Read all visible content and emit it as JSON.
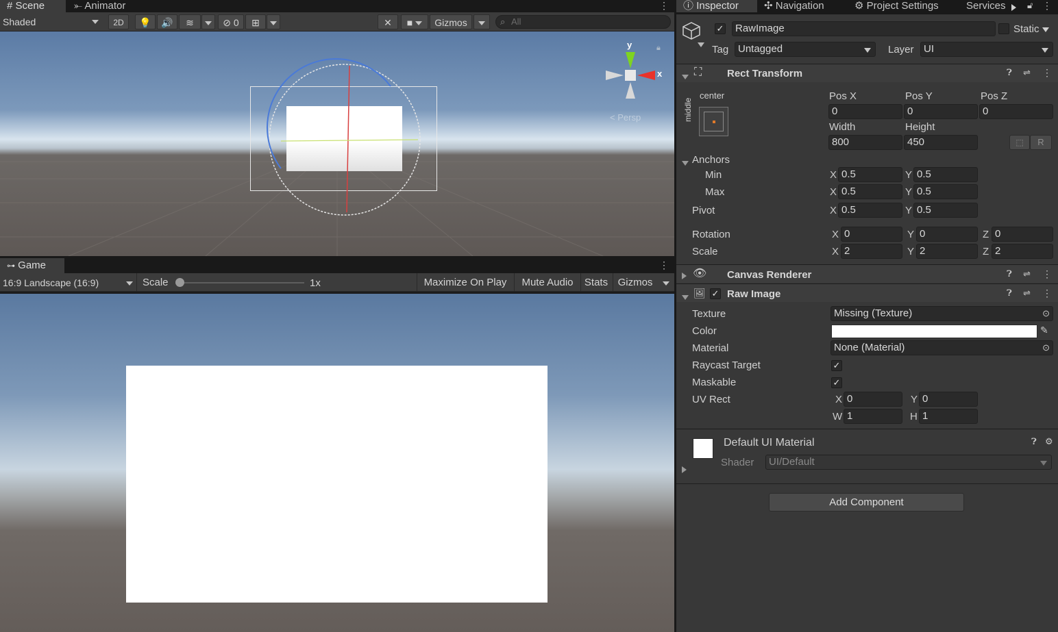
{
  "scene_tabs": {
    "scene": "Scene",
    "animator": "Animator"
  },
  "scene_toolbar": {
    "shading": "Shaded",
    "two_d": "2D",
    "hidden_count": "0",
    "gizmos": "Gizmos",
    "search_placeholder": "All"
  },
  "scene_gizmo": {
    "y": "y",
    "x": "x",
    "mode": "Persp"
  },
  "game_tab": {
    "label": "Game"
  },
  "game_toolbar": {
    "aspect": "16:9 Landscape (16:9)",
    "scale_label": "Scale",
    "scale_value": "1x",
    "maximize": "Maximize On Play",
    "mute": "Mute Audio",
    "stats": "Stats",
    "gizmos": "Gizmos"
  },
  "inspector_tabs": {
    "inspector": "Inspector",
    "navigation": "Navigation",
    "project_settings": "Project Settings",
    "services": "Services"
  },
  "object": {
    "name": "RawImage",
    "static_label": "Static",
    "tag_label": "Tag",
    "tag": "Untagged",
    "layer_label": "Layer",
    "layer": "UI"
  },
  "rect_transform": {
    "title": "Rect Transform",
    "anchor_h": "center",
    "anchor_v": "middle",
    "pos_x_label": "Pos X",
    "pos_y_label": "Pos Y",
    "pos_z_label": "Pos Z",
    "pos_x": "0",
    "pos_y": "0",
    "pos_z": "0",
    "width_label": "Width",
    "height_label": "Height",
    "width": "800",
    "height": "450",
    "anchors_label": "Anchors",
    "min_label": "Min",
    "max_label": "Max",
    "pivot_label": "Pivot",
    "min_x": "0.5",
    "min_y": "0.5",
    "max_x": "0.5",
    "max_y": "0.5",
    "pivot_x": "0.5",
    "pivot_y": "0.5",
    "rotation_label": "Rotation",
    "rot_x": "0",
    "rot_y": "0",
    "rot_z": "0",
    "scale_label": "Scale",
    "scale_x": "2",
    "scale_y": "2",
    "scale_z": "2",
    "r_button": "R"
  },
  "canvas_renderer": {
    "title": "Canvas Renderer"
  },
  "raw_image": {
    "title": "Raw Image",
    "texture_label": "Texture",
    "texture": "Missing (Texture)",
    "color_label": "Color",
    "color": "#ffffff",
    "material_label": "Material",
    "material": "None (Material)",
    "raycast_label": "Raycast Target",
    "maskable_label": "Maskable",
    "uv_label": "UV Rect",
    "uv_x": "0",
    "uv_y": "0",
    "uv_w": "1",
    "uv_h": "1"
  },
  "material": {
    "name": "Default UI Material",
    "shader_label": "Shader",
    "shader": "UI/Default"
  },
  "add_component": "Add Component",
  "axes": {
    "x": "X",
    "y": "Y",
    "z": "Z",
    "w": "W",
    "h": "H"
  }
}
